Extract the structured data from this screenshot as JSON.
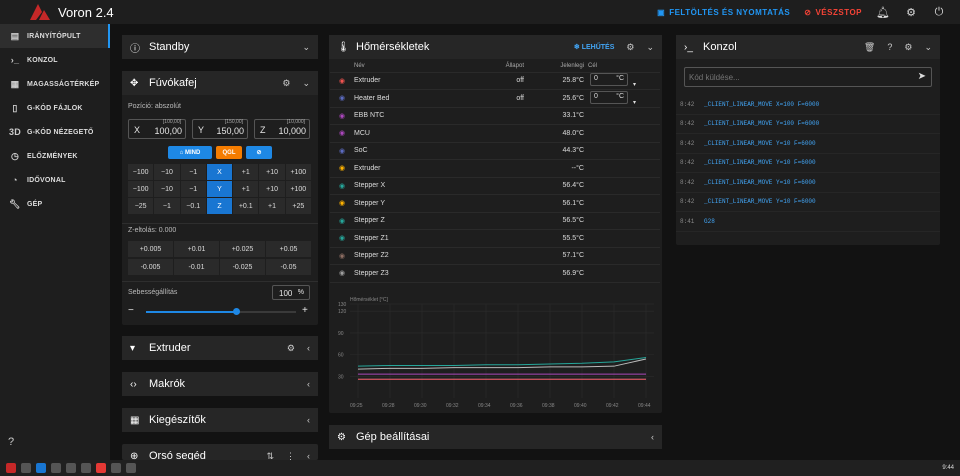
{
  "app": {
    "title": "Voron 2.4",
    "upload_label": "FELTÖLTÉS ÉS NYOMTATÁS",
    "estop_label": "VÉSZSTOP"
  },
  "nav": [
    {
      "label": "IRÁNYÍTÓPULT",
      "icon": "dashboard-icon",
      "active": true
    },
    {
      "label": "KONZOL",
      "icon": "console-icon"
    },
    {
      "label": "MAGASSÁGTÉRKÉP",
      "icon": "grid-icon"
    },
    {
      "label": "G-KÓD FÁJLOK",
      "icon": "file-icon"
    },
    {
      "label": "G-KÓD NÉZEGETŐ",
      "icon": "3d-icon"
    },
    {
      "label": "ELŐZMÉNYEK",
      "icon": "history-icon"
    },
    {
      "label": "IDŐVONAL",
      "icon": "timeline-icon"
    },
    {
      "label": "GÉP",
      "icon": "wrench-icon"
    }
  ],
  "standby": {
    "title": "Standby"
  },
  "toolhead": {
    "title": "Fúvókafej",
    "position_label": "Pozíció: abszolút",
    "x_label": "X",
    "x_value": "100,00",
    "x_hint": "[100,00]",
    "y_label": "Y",
    "y_value": "150,00",
    "y_hint": "[150,00]",
    "z_label": "Z",
    "z_value": "10,000",
    "z_hint": "[10,000]",
    "home_all": "MIND",
    "qgl": "QGL",
    "row_x": [
      "−100",
      "−10",
      "−1",
      "X",
      "+1",
      "+10",
      "+100"
    ],
    "row_y": [
      "−100",
      "−10",
      "−1",
      "Y",
      "+1",
      "+10",
      "+100"
    ],
    "row_z": [
      "−25",
      "−1",
      "−0.1",
      "Z",
      "+0.1",
      "+1",
      "+25"
    ],
    "zoffset_label": "Z-eltolás: 0.000",
    "zoff_up": [
      "+0.005",
      "+0.01",
      "+0.025",
      "+0.05"
    ],
    "zoff_down": [
      "-0.005",
      "-0.01",
      "-0.025",
      "-0.05"
    ],
    "speed_label": "Sebességállítás",
    "speed_value": "100",
    "speed_unit": "%",
    "speed_fraction": 0.6
  },
  "extruder_card": {
    "title": "Extruder"
  },
  "macros_card": {
    "title": "Makrók"
  },
  "accessories_card": {
    "title": "Kiegészítők"
  },
  "spindle_card": {
    "title": "Orsó segéd"
  },
  "temps": {
    "title": "Hőmérsékletek",
    "preheat": "LEHŰTÉS",
    "col_name": "Név",
    "col_state": "Állapot",
    "col_current": "Jelenlegi",
    "col_target": "Cél",
    "rows": [
      {
        "name": "Extruder",
        "state": "off",
        "current": "25.8°C",
        "target": "0",
        "unit": "°C",
        "color": "#ef5350"
      },
      {
        "name": "Heater Bed",
        "state": "off",
        "current": "25.6°C",
        "target": "0",
        "unit": "°C",
        "color": "#5c6bc0"
      },
      {
        "name": "EBB NTC",
        "current": "33.1°C",
        "color": "#ab47bc"
      },
      {
        "name": "MCU",
        "current": "48.0°C",
        "color": "#ab47bc"
      },
      {
        "name": "SoC",
        "current": "44.3°C",
        "color": "#5c6bc0"
      },
      {
        "name": "Extruder",
        "current": "--°C",
        "color": "#ffb300"
      },
      {
        "name": "Stepper X",
        "current": "56.4°C",
        "color": "#26a69a"
      },
      {
        "name": "Stepper Y",
        "current": "56.1°C",
        "color": "#ffb300"
      },
      {
        "name": "Stepper Z",
        "current": "56.5°C",
        "color": "#26a69a"
      },
      {
        "name": "Stepper Z1",
        "current": "55.5°C",
        "color": "#26a69a"
      },
      {
        "name": "Stepper Z2",
        "current": "57.1°C",
        "color": "#8d6e63"
      },
      {
        "name": "Stepper Z3",
        "current": "56.9°C",
        "color": "#9e9e9e"
      }
    ]
  },
  "chart_data": {
    "type": "line",
    "ylabel": "Hőmérséklet [°C]",
    "yticks": [
      "130",
      "120",
      "90",
      "60",
      "30"
    ],
    "ylim": [
      0,
      130
    ],
    "x": [
      "09:25",
      "09:28",
      "09:30",
      "09:32",
      "09:34",
      "09:36",
      "09:38",
      "09:40",
      "09:42",
      "09:44"
    ],
    "series": [
      {
        "color": "#26a69a",
        "values": [
          44,
          45,
          45,
          45,
          46,
          46,
          47,
          48,
          50,
          56
        ]
      },
      {
        "color": "#ab47bc",
        "values": [
          33,
          33,
          33,
          33,
          33,
          33,
          33,
          33,
          33,
          33
        ]
      },
      {
        "color": "#5c6bc0",
        "values": [
          26,
          26,
          26,
          26,
          26,
          26,
          26,
          26,
          26,
          26
        ]
      },
      {
        "color": "#ef5350",
        "values": [
          26,
          26,
          26,
          26,
          26,
          26,
          26,
          26,
          26,
          26
        ]
      },
      {
        "color": "#bbbbbb",
        "values": [
          40,
          41,
          41,
          42,
          42,
          42,
          43,
          43,
          44,
          54
        ]
      }
    ]
  },
  "machine_settings": {
    "title": "Gép beállításai"
  },
  "console": {
    "title": "Konzol",
    "placeholder": "Kód küldése...",
    "lines": [
      {
        "time": "8:42",
        "cmd": "_CLIENT_LINEAR_MOVE X=100 F=6000"
      },
      {
        "time": "8:42",
        "cmd": "_CLIENT_LINEAR_MOVE Y=100 F=6000"
      },
      {
        "time": "8:42",
        "cmd": "_CLIENT_LINEAR_MOVE Y=10 F=6000"
      },
      {
        "time": "8:42",
        "cmd": "_CLIENT_LINEAR_MOVE Y=10 F=6000"
      },
      {
        "time": "8:42",
        "cmd": "_CLIENT_LINEAR_MOVE Y=10 F=6000"
      },
      {
        "time": "8:42",
        "cmd": "_CLIENT_LINEAR_MOVE Y=10 F=6000"
      },
      {
        "time": "8:41",
        "cmd": "G28"
      }
    ]
  },
  "taskbar": {
    "time": "9:44"
  }
}
